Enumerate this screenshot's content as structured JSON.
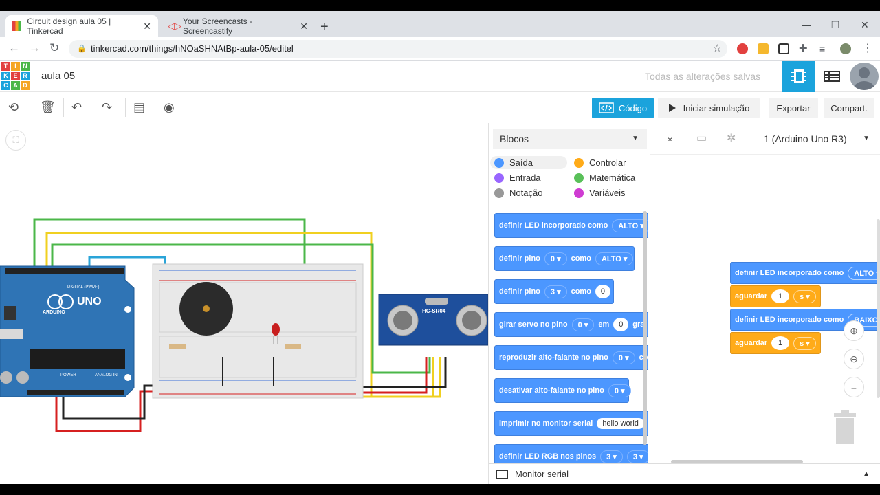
{
  "browser": {
    "tabs": [
      {
        "title": "Circuit design aula 05 | Tinkercad"
      },
      {
        "title": "Your Screencasts - Screencastify"
      }
    ],
    "url": "tinkercad.com/things/hNOaSHNAtBp-aula-05/editel"
  },
  "header": {
    "logo_letters": [
      "TIN",
      "KER",
      "CAD"
    ],
    "project_title": "aula 05",
    "save_status": "Todas as alterações salvas"
  },
  "toolbar": {
    "code_label": "Código",
    "simulate_label": "Iniciar simulação",
    "export_label": "Exportar",
    "share_label": "Compart."
  },
  "circuit": {
    "arduino_brand": "UNO",
    "arduino_sub": "ARDUINO",
    "digital_label": "DIGITAL (PWM~)",
    "power_label": "POWER",
    "analog_label": "ANALOG IN",
    "sensor_label": "HC-SR04"
  },
  "code_panel": {
    "blocks_dropdown": "Blocos",
    "device_dropdown": "1 (Arduino Uno R3)",
    "categories": [
      {
        "label": "Saída",
        "color": "#4c97ff"
      },
      {
        "label": "Controlar",
        "color": "#ffab19"
      },
      {
        "label": "Entrada",
        "color": "#9966ff"
      },
      {
        "label": "Matemática",
        "color": "#59c059"
      },
      {
        "label": "Notação",
        "color": "#999999"
      },
      {
        "label": "Variáveis",
        "color": "#cf3cd2"
      }
    ],
    "palette": {
      "b1": {
        "text": "definir LED incorporado como",
        "dd": "ALTO"
      },
      "b2": {
        "text": "definir pino",
        "dd1": "0",
        "mid": "como",
        "dd2": "ALTO"
      },
      "b3": {
        "text": "definir pino",
        "dd1": "3",
        "mid": "como",
        "num": "0"
      },
      "b4": {
        "text": "girar servo no pino",
        "dd1": "0",
        "mid": "em",
        "num": "0",
        "tail": "gra"
      },
      "b5": {
        "text": "reproduzir alto-falante no pino",
        "dd1": "0",
        "tail": "co"
      },
      "b6": {
        "text": "desativar alto-falante no pino",
        "dd1": "0"
      },
      "b7": {
        "text": "imprimir no monitor serial",
        "pill": "hello world"
      },
      "b8": {
        "text": "definir LED RGB nos pinos",
        "dd1": "3",
        "dd2": "3"
      }
    },
    "script": {
      "s1": {
        "text": "definir LED incorporado como",
        "dd": "ALTO"
      },
      "s2": {
        "text": "aguardar",
        "num": "1",
        "dd": "s"
      },
      "s3": {
        "text": "definir LED incorporado como",
        "dd": "BAIXO"
      },
      "s4": {
        "text": "aguardar",
        "num": "1",
        "dd": "s"
      }
    },
    "serial_monitor": "Monitor serial"
  }
}
